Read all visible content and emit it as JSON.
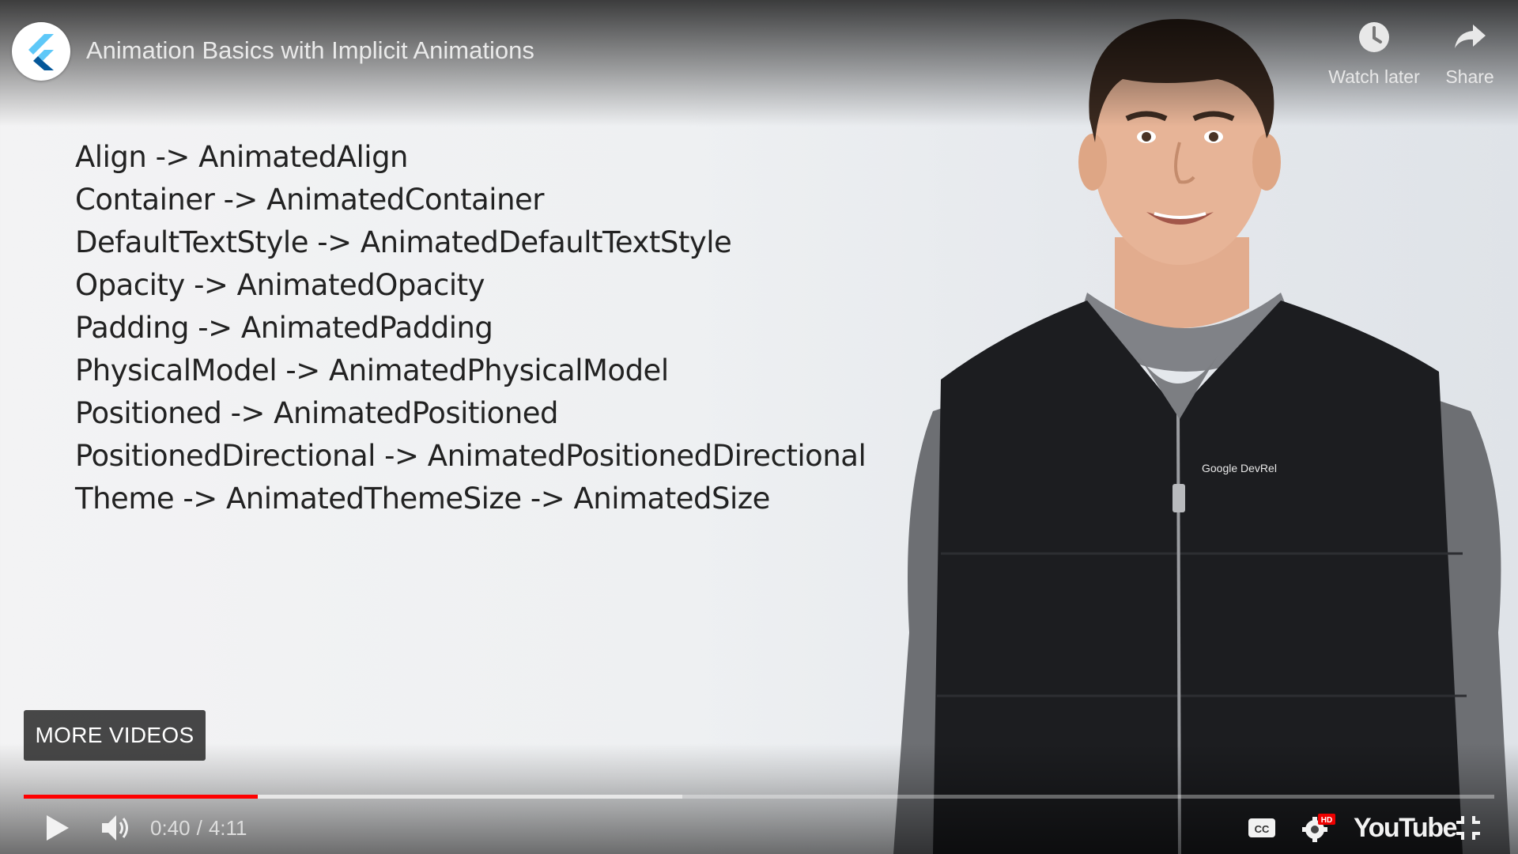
{
  "player": {
    "title": "Animation Basics with Implicit Animations",
    "watch_later_label": "Watch later",
    "share_label": "Share",
    "more_videos_label": "MORE VIDEOS",
    "current_time": "0:40",
    "separator": "/",
    "duration": "4:11",
    "progress_played_fraction": 0.159,
    "progress_loaded_fraction": 0.448,
    "hd_badge": "HD",
    "brand_label": "YouTube",
    "accent_color": "#ff0000"
  },
  "slide": {
    "lines": [
      "Align -> AnimatedAlign",
      "Container -> AnimatedContainer",
      "DefaultTextStyle -> AnimatedDefaultTextStyle",
      "Opacity -> AnimatedOpacity",
      "Padding -> AnimatedPadding",
      "PhysicalModel -> AnimatedPhysicalModel",
      "Positioned -> AnimatedPositioned",
      "PositionedDirectional -> AnimatedPositionedDirectional",
      "Theme -> AnimatedThemeSize -> AnimatedSize"
    ]
  },
  "presenter": {
    "vest_logo_text": "Google DevRel"
  }
}
